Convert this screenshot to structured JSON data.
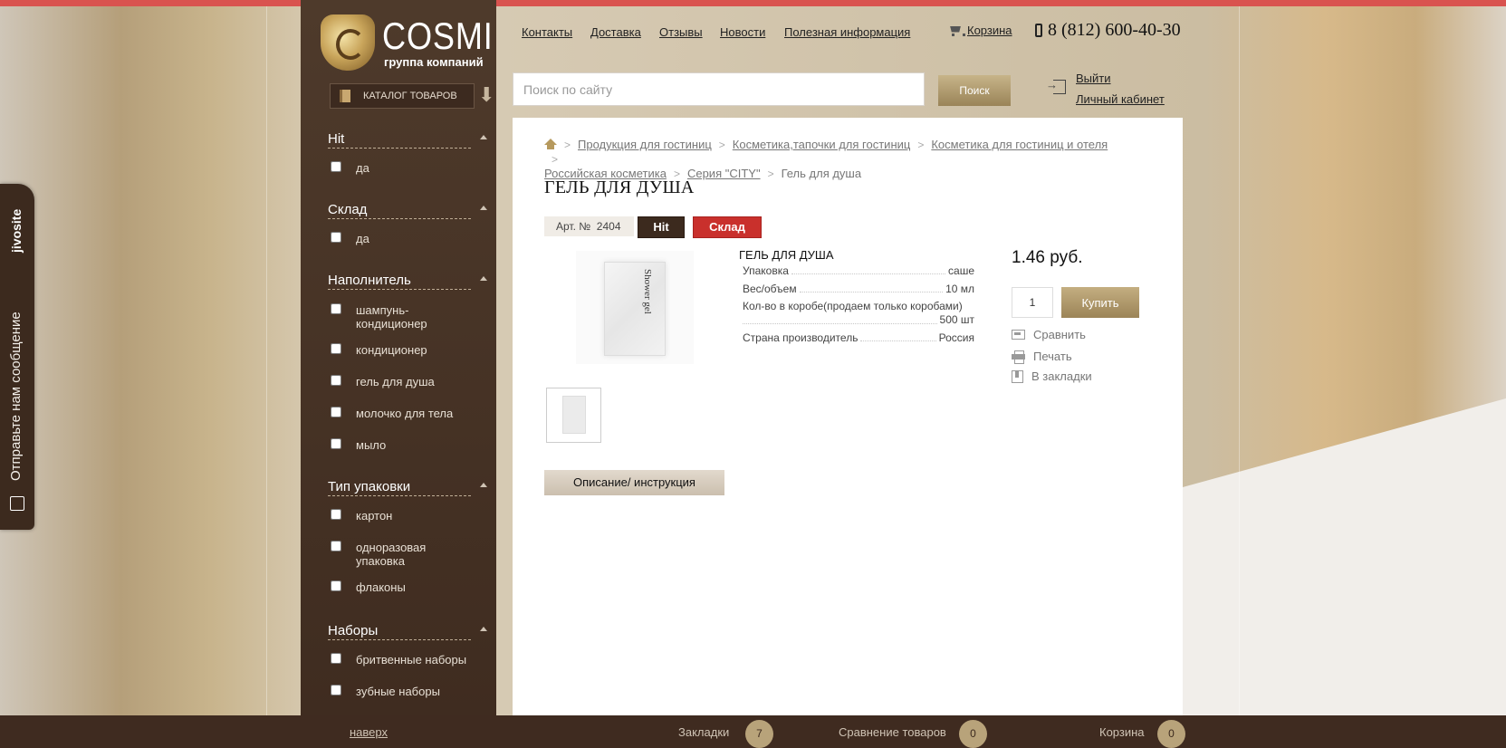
{
  "brand": {
    "name": "COSMI",
    "subtitle": "группа компаний",
    "catalog_label": "КАТАЛОГ ТОВАРОВ"
  },
  "nav": {
    "links": [
      "Контакты",
      "Доставка",
      "Отзывы",
      "Новости",
      "Полезная информация"
    ],
    "cart": "Корзина",
    "phone": "8 (812) 600-40-30"
  },
  "search": {
    "placeholder": "Поиск по сайту",
    "button": "Поиск"
  },
  "account": {
    "logout": "Выйти",
    "cabinet": "Личный кабинет"
  },
  "filters": [
    {
      "title": "Hit",
      "items": [
        "да"
      ]
    },
    {
      "title": "Склад",
      "items": [
        "да"
      ]
    },
    {
      "title": "Наполнитель",
      "items": [
        "шампунь-кондиционер",
        "кондиционер",
        "гель для душа",
        "молочко для тела",
        "мыло"
      ]
    },
    {
      "title": "Тип упаковки",
      "items": [
        "картон",
        "одноразовая упаковка",
        "флаконы"
      ]
    },
    {
      "title": "Наборы",
      "items": [
        "бритвенные наборы",
        "зубные наборы"
      ]
    }
  ],
  "breadcrumb": {
    "links": [
      "Продукция для гостиниц",
      "Косметика,тапочки для гостиниц",
      "Косметика для гостиниц и отеля",
      "Российская косметика",
      "Серия \"CITY\""
    ],
    "current": "Гель для душа"
  },
  "product": {
    "title": "ГЕЛЬ ДЛЯ ДУША",
    "article_label": "Арт. №",
    "article": "2404",
    "badges": {
      "hit": "Hit",
      "stock": "Склад"
    },
    "image_text": "Shower gel",
    "props_title": "ГЕЛЬ ДЛЯ ДУША",
    "props": [
      {
        "name": "Упаковка",
        "value": "саше"
      },
      {
        "name": "Вес/объем",
        "value": "10 мл"
      },
      {
        "name": "Кол-во в коробе(продаем только коробами)",
        "value": "500 шт"
      },
      {
        "name": "Страна производитель",
        "value": "Россия"
      }
    ],
    "price": "1.46 руб.",
    "quantity": "1",
    "buy_label": "Купить",
    "actions": {
      "compare": "Сравнить",
      "print": "Печать",
      "bookmark": "В закладки"
    },
    "description_tab": "Описание/ инструкция"
  },
  "jivosite": {
    "brand": "jivosite",
    "message": "Отправьте нам сообщение"
  },
  "footer": {
    "to_top": "наверх",
    "bookmarks_label": "Закладки",
    "bookmarks_count": "7",
    "compare_label": "Сравнение товаров",
    "compare_count": "0",
    "cart_label": "Корзина",
    "cart_count": "0"
  },
  "colors": {
    "accent_red": "#d9534f",
    "sidebar_brown": "#4e3a2b",
    "gold": "#b8a37a",
    "stock_red": "#c9302c"
  }
}
